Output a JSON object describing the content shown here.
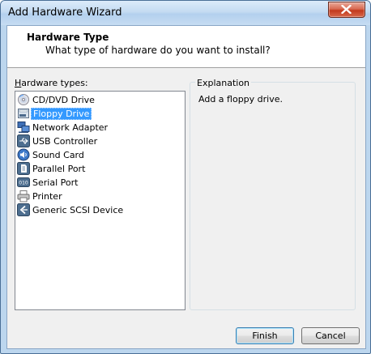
{
  "window": {
    "title": "Add Hardware Wizard"
  },
  "header": {
    "title": "Hardware Type",
    "subtitle": "What type of hardware do you want to install?"
  },
  "list": {
    "label_underlined": "H",
    "label_rest": "ardware types:",
    "items": [
      {
        "label": "CD/DVD Drive",
        "icon": "cd-dvd-drive-icon",
        "selected": false
      },
      {
        "label": "Floppy Drive",
        "icon": "floppy-drive-icon",
        "selected": true
      },
      {
        "label": "Network Adapter",
        "icon": "network-adapter-icon",
        "selected": false
      },
      {
        "label": "USB Controller",
        "icon": "usb-controller-icon",
        "selected": false
      },
      {
        "label": "Sound Card",
        "icon": "sound-card-icon",
        "selected": false
      },
      {
        "label": "Parallel Port",
        "icon": "parallel-port-icon",
        "selected": false
      },
      {
        "label": "Serial Port",
        "icon": "serial-port-icon",
        "selected": false
      },
      {
        "label": "Printer",
        "icon": "printer-icon",
        "selected": false
      },
      {
        "label": "Generic SCSI Device",
        "icon": "scsi-device-icon",
        "selected": false
      }
    ]
  },
  "explanation": {
    "label": "Explanation",
    "text": "Add a floppy drive."
  },
  "buttons": {
    "finish": "Finish",
    "cancel": "Cancel"
  }
}
